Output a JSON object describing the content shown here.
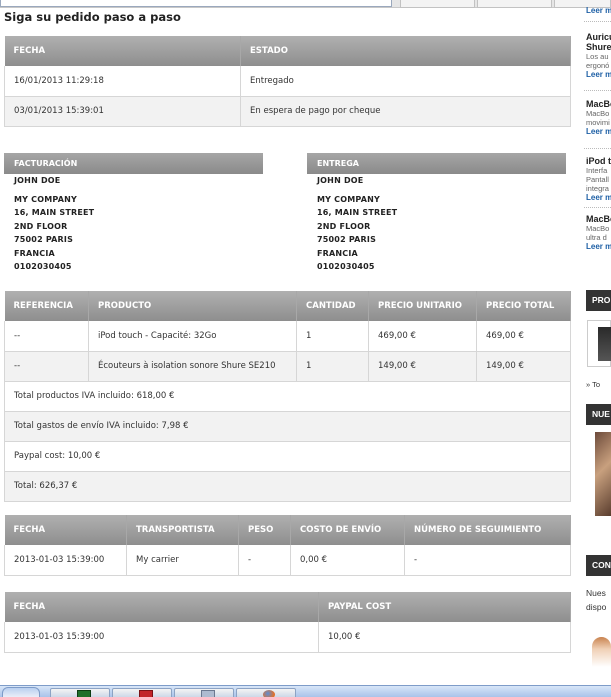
{
  "page_title": "Siga su pedido paso a paso",
  "status_table": {
    "headers": [
      "FECHA",
      "ESTADO"
    ],
    "rows": [
      [
        "16/01/2013 11:29:18",
        "Entregado"
      ],
      [
        "03/01/2013 15:39:01",
        "En espera de pago por cheque"
      ]
    ]
  },
  "billing": {
    "title": "FACTURACIÓN",
    "lines": [
      "JOHN DOE",
      "MY COMPANY",
      "16, MAIN STREET",
      "2ND FLOOR",
      "75002 PARIS",
      "FRANCIA",
      "0102030405"
    ]
  },
  "delivery": {
    "title": "ENTREGA",
    "lines": [
      "JOHN DOE",
      "MY COMPANY",
      "16, MAIN STREET",
      "2ND FLOOR",
      "75002 PARIS",
      "FRANCIA",
      "0102030405"
    ]
  },
  "products_table": {
    "headers": [
      "REFERENCIA",
      "PRODUCTO",
      "CANTIDAD",
      "PRECIO UNITARIO",
      "PRECIO TOTAL"
    ],
    "rows": [
      [
        "--",
        "iPod touch - Capacité: 32Go",
        "1",
        "469,00 €",
        "469,00 €"
      ],
      [
        "--",
        "Écouteurs à isolation sonore Shure SE210",
        "1",
        "149,00 €",
        "149,00 €"
      ]
    ],
    "totals": [
      "Total productos IVA incluido: 618,00 €",
      "Total gastos de envío IVA incluido: 7,98 €",
      "Paypal cost: 10,00 €",
      "Total: 626,37 €"
    ]
  },
  "shipping_table": {
    "headers": [
      "FECHA",
      "TRANSPORTISTA",
      "PESO",
      "COSTO DE ENVÍO",
      "NÚMERO DE SEGUIMIENTO"
    ],
    "rows": [
      [
        "2013-01-03 15:39:00",
        "My carrier",
        "-",
        "0,00 €",
        "-"
      ]
    ]
  },
  "paypal_table": {
    "headers": [
      "FECHA",
      "PAYPAL COST"
    ],
    "rows": [
      [
        "2013-01-03 15:39:00",
        "10,00 €"
      ]
    ]
  },
  "sidebar": {
    "more_link": "Leer m",
    "items": [
      {
        "title": "Auricu",
        "subtitle": "Shure",
        "desc": [
          "Los au",
          "ergonó"
        ],
        "more": "Leer m"
      },
      {
        "title": "MacBo",
        "desc": [
          "MacBo",
          "movimi"
        ],
        "more": "Leer m"
      },
      {
        "title": "iPod t",
        "desc": [
          "Interfa",
          "Pantall",
          "integra"
        ],
        "more": "Leer m"
      },
      {
        "title": "MacBo",
        "desc": [
          "MacBo",
          "ultra d"
        ],
        "more": "Leer m"
      }
    ],
    "block_pro": "PRO",
    "block_pro_link": "» To",
    "block_nue": "NUE",
    "block_con": "CON",
    "con_text": [
      "Nues",
      "dispo"
    ]
  },
  "colors": {
    "header_gradient_top": "#b0b0b0",
    "header_gradient_bottom": "#8e8e8e",
    "alt_row": "#f2f2f2",
    "link": "#1d5fa5",
    "sidebar_block": "#333333"
  }
}
